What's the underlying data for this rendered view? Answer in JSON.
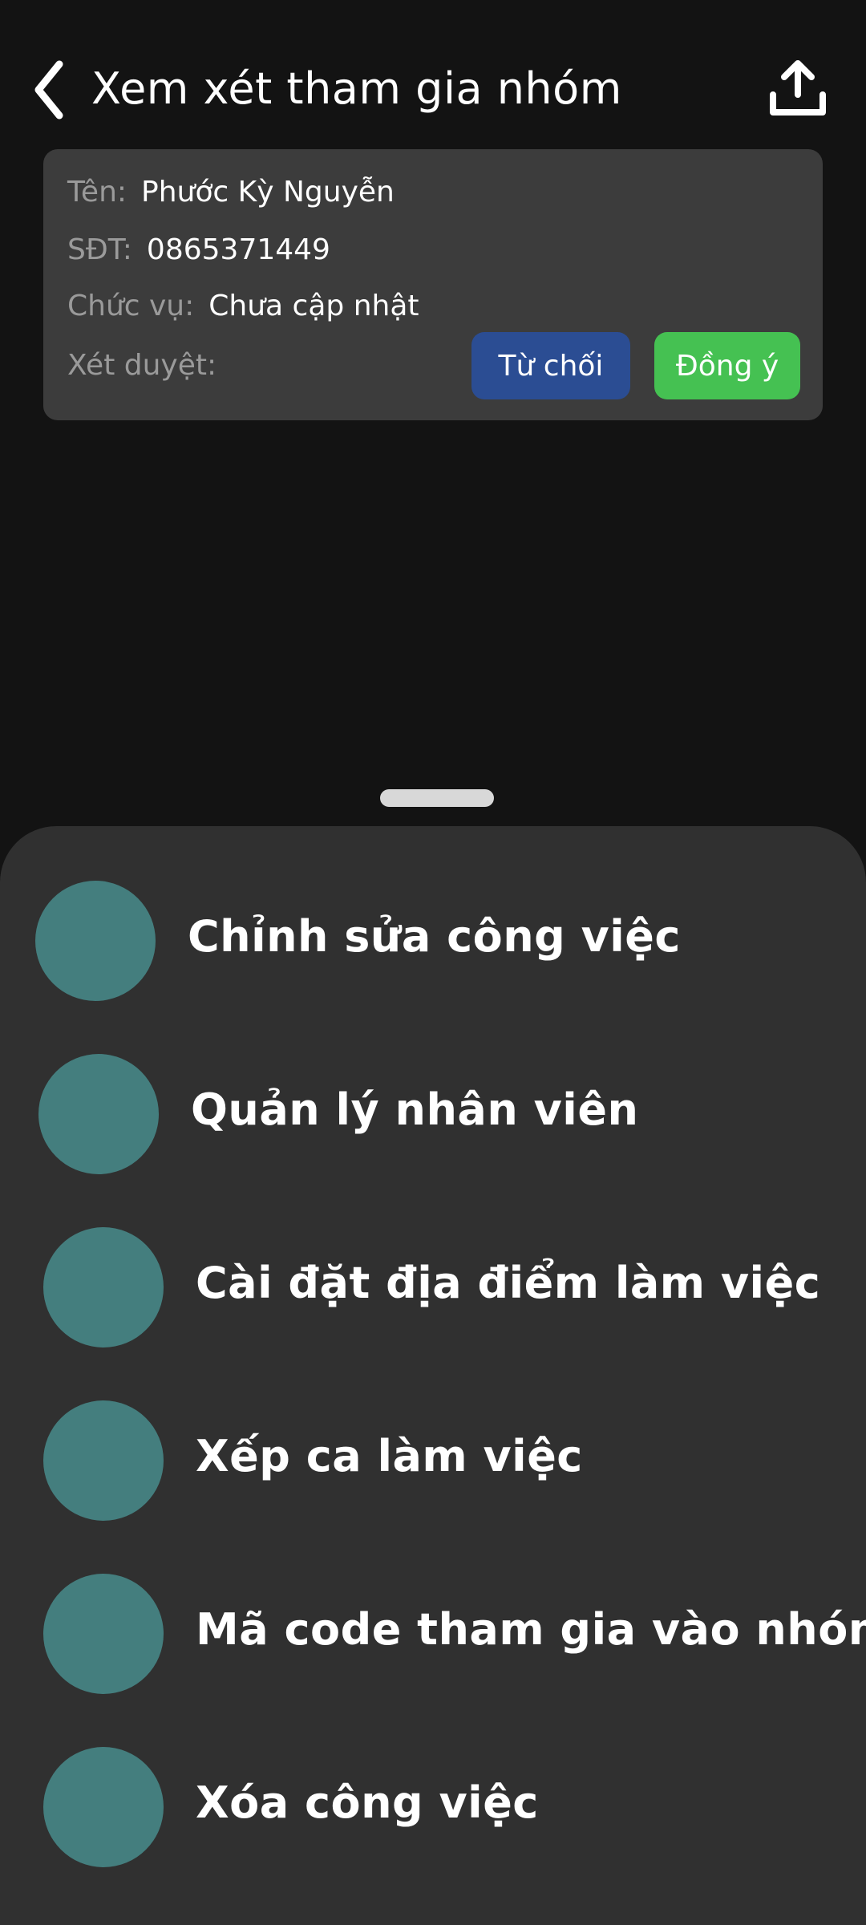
{
  "header": {
    "title": "Xem xét tham gia nhóm",
    "back_icon": "chevron-left-icon",
    "upload_icon": "upload-icon"
  },
  "request": {
    "name_label": "Tên:",
    "name_value": "Phước Kỳ Nguyễn",
    "phone_label": "SĐT:",
    "phone_value": "0865371449",
    "position_label": "Chức vụ:",
    "position_value": "Chưa cập nhật",
    "review_label": "Xét duyệt:",
    "reject_label": "Từ chối",
    "approve_label": "Đồng ý"
  },
  "sheet": {
    "items": [
      {
        "label": "Chỉnh sửa công việc"
      },
      {
        "label": "Quản lý nhân viên"
      },
      {
        "label": "Cài đặt địa điểm làm việc"
      },
      {
        "label": "Xếp ca làm việc"
      },
      {
        "label": "Mã code tham gia vào nhóm"
      },
      {
        "label": "Xóa công việc"
      }
    ]
  },
  "colors": {
    "background": "#131313",
    "card": "#3c3c3c",
    "sheet": "#303030",
    "reject": "#2b4d93",
    "approve": "#45c152",
    "icon_circle": "#447e7e"
  }
}
